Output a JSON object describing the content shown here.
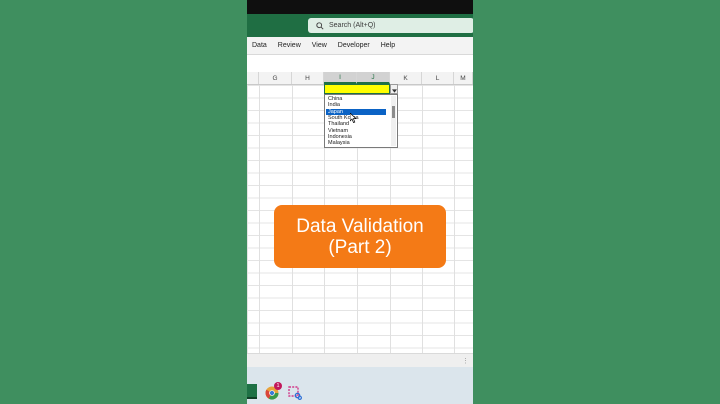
{
  "search": {
    "placeholder": "Search (Alt+Q)"
  },
  "ribbon": {
    "tabs": [
      "Data",
      "Review",
      "View",
      "Developer",
      "Help"
    ]
  },
  "columns": [
    "G",
    "H",
    "I",
    "J",
    "K",
    "L",
    "M"
  ],
  "dropdown": {
    "items": [
      "China",
      "India",
      "Japan",
      "South Korea",
      "Thailand",
      "Vietnam",
      "Indonesia",
      "Malaysia"
    ],
    "highlighted": "Japan"
  },
  "overlay": {
    "line1": "Data Validation",
    "line2": "(Part 2)"
  },
  "taskbar": {
    "notification_count": "1"
  },
  "colors": {
    "excel_green": "#1f6e43",
    "active_cell_fill": "#ffff00",
    "overlay_orange": "#f47a16",
    "selection_blue": "#0b63c5",
    "background_green": "#3e8e5e"
  },
  "icons": [
    "search-icon",
    "dropdown-arrow-icon",
    "mouse-cursor-icon",
    "excel-app-icon",
    "chrome-app-icon",
    "snipping-tool-icon"
  ]
}
